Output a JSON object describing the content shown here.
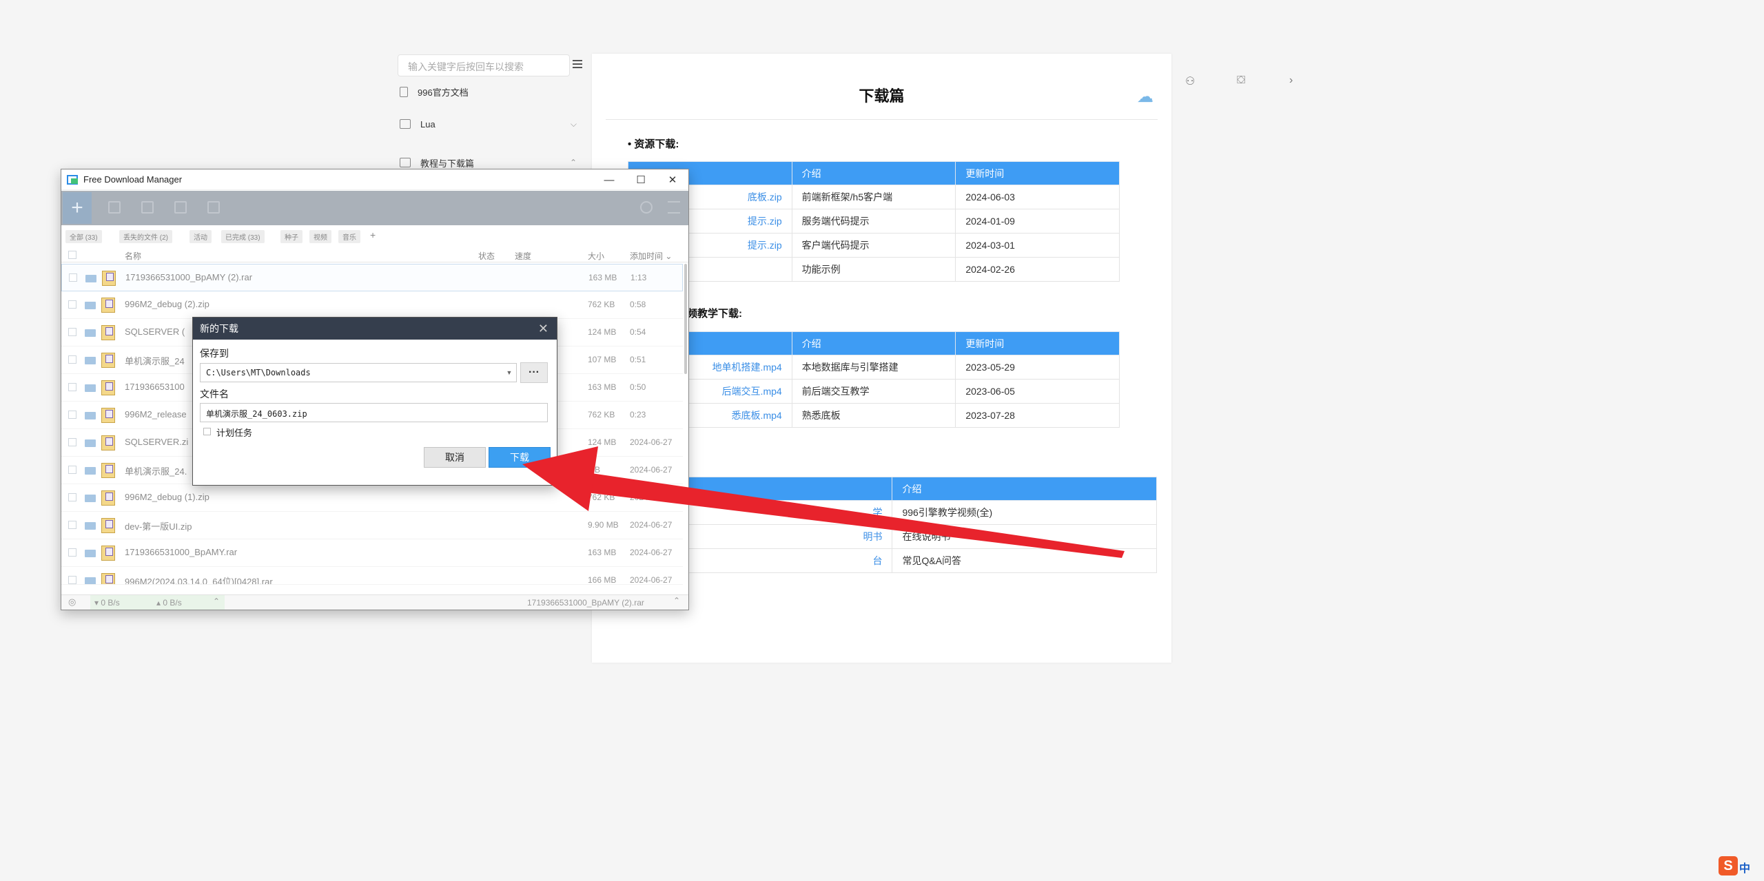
{
  "doc_site": {
    "search_placeholder": "输入关键字后按回车以搜索",
    "sidebar_items": [
      {
        "label": "996官方文档",
        "icon": "document-icon"
      },
      {
        "label": "Lua",
        "icon": "folder-icon",
        "expand": "⌵"
      },
      {
        "label": "教程与下载篇",
        "icon": "folder-icon",
        "expand": "⌃"
      }
    ],
    "page_title": "下载篇",
    "section1_heading": "• 资源下载:",
    "section2_heading": "频教学下载:",
    "table1": {
      "headers": [
        "",
        "介绍",
        "更新时间"
      ],
      "rows": [
        [
          "底板.zip",
          "前端新框架/h5客户端",
          "2024-06-03"
        ],
        [
          "提示.zip",
          "服务端代码提示",
          "2024-01-09"
        ],
        [
          "提示.zip",
          "客户端代码提示",
          "2024-03-01"
        ],
        [
          "",
          "功能示例",
          "2024-02-26"
        ]
      ]
    },
    "table2": {
      "headers": [
        "",
        "介绍",
        "更新时间"
      ],
      "rows": [
        [
          "地单机搭建.mp4",
          "本地数据库与引擎搭建",
          "2023-05-29"
        ],
        [
          "后端交互.mp4",
          "前后端交互教学",
          "2023-06-05"
        ],
        [
          "悉底板.mp4",
          "熟悉底板",
          "2023-07-28"
        ]
      ]
    },
    "table3": {
      "headers": [
        "",
        "介绍"
      ],
      "rows": [
        [
          "学",
          "996引擎教学视频(全)"
        ],
        [
          "明书",
          "在线说明书"
        ],
        [
          "台",
          "常见Q&A问答"
        ]
      ]
    }
  },
  "fdm": {
    "window_title": "Free Download Manager",
    "window_controls": {
      "minimize": "—",
      "maximize": "☐",
      "close": "✕"
    },
    "toolbar_add": "+",
    "filters": [
      "全部 (33)",
      "丢失的文件 (2)",
      "活动",
      "已完成 (33)",
      "种子",
      "视频",
      "音乐",
      "+"
    ],
    "columns": {
      "name": "名称",
      "status": "状态",
      "speed": "速度",
      "size": "大小",
      "added": "添加时间 ⌄"
    },
    "rows": [
      {
        "name": "1719366531000_BpAMY (2).rar",
        "size": "163 MB",
        "time": "1:13"
      },
      {
        "name": "996M2_debug (2).zip",
        "size": "762 KB",
        "time": "0:58"
      },
      {
        "name": "SQLSERVER (",
        "size": "124 MB",
        "time": "0:54"
      },
      {
        "name": "单机演示服_24",
        "size": "107 MB",
        "time": "0:51"
      },
      {
        "name": "171936653100",
        "size": "163 MB",
        "time": "0:50"
      },
      {
        "name": "996M2_release",
        "size": "762 KB",
        "time": "0:23"
      },
      {
        "name": "SQLSERVER.zi",
        "size": "124 MB",
        "time": "2024-06-27"
      },
      {
        "name": "单机演示服_24.",
        "size": "MB",
        "time": "2024-06-27"
      },
      {
        "name": "996M2_debug (1).zip",
        "size": "762 KB",
        "time": "2024-06-27"
      },
      {
        "name": "dev-第一版UI.zip",
        "size": "9.90 MB",
        "time": "2024-06-27"
      },
      {
        "name": "1719366531000_BpAMY.rar",
        "size": "163 MB",
        "time": "2024-06-27"
      },
      {
        "name": "996M2(2024.03.14.0_64位)[0428].rar",
        "size": "166 MB",
        "time": "2024-06-27"
      }
    ],
    "status_bar": {
      "down_speed": "▾ 0 B/s",
      "up_speed": "▴ 0 B/s",
      "current_file": "1719366531000_BpAMY (2).rar"
    }
  },
  "dialog": {
    "title": "新的下载",
    "save_to_label": "保存到",
    "save_path": "C:\\Users\\MT\\Downloads",
    "filename_label": "文件名",
    "filename": "单机演示服_24_0603.zip",
    "schedule_label": "计划任务",
    "cancel_label": "取消",
    "download_label": "下载",
    "more_label": "···"
  },
  "ime": {
    "logo": "S",
    "mode": "中"
  },
  "colors": {
    "accent": "#3c9ff1",
    "table_header": "#3e9cf4",
    "arrow": "#e8232c",
    "dialog_title_bg": "#353e4d"
  }
}
